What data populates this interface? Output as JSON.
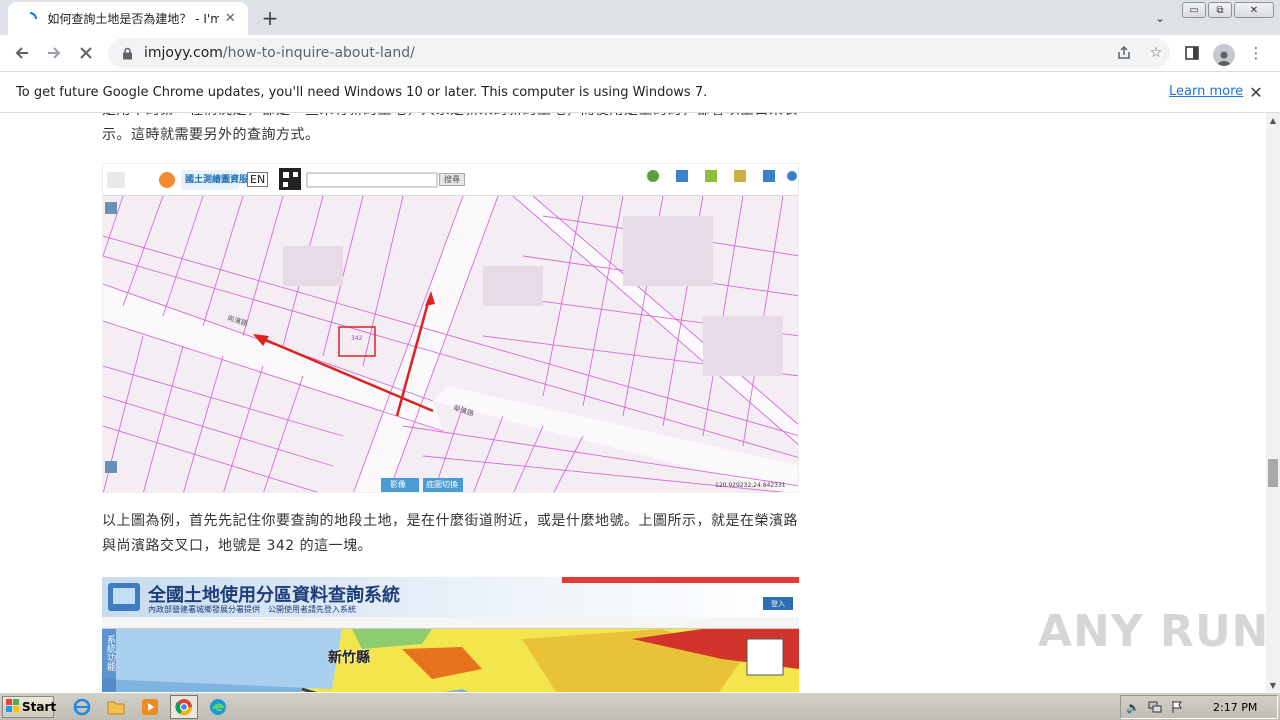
{
  "tab": {
    "title": "如何查詢土地是否為建地？ - I'm Joyy"
  },
  "window": {
    "minimize": "▭",
    "restore": "⧉",
    "close": "✕"
  },
  "address": {
    "domain": "imjoyy.com",
    "path": "/how-to-inquire-about-land/"
  },
  "infobar": {
    "message": "To get future Google Chrome updates, you'll need Windows 10 or later. This computer is using Windows 7.",
    "link": "Learn more"
  },
  "article": {
    "para_top": "是用中的第一種情況是，都是一些未有新的土地，大家是新來的新的土地，而使用是空的的，都會以空白來表示。這時就需要另外的查詢方式。",
    "para_mid": "以上圖為例，首先先記住你要查詢的地段土地，是在什麼街道附近，或是什麼地號。上圖所示，就是在榮濱路與尚濱路交叉口，地號是 342 的這一塊。",
    "fig1": {
      "brand": "國土測繪圖資服務雲",
      "lang": "EN",
      "search_btn": "搜尋",
      "map_btn_1": "影像",
      "map_btn_2": "底圖切換",
      "coords": "120.929232,24.842331",
      "parcel": "342",
      "street_1": "尚濱路",
      "street_2": "榮濱路"
    },
    "fig2": {
      "title": "全國土地使用分區資料查詢系統",
      "subtitle": "內政部營建署城鄉發展分署提供　公開使用者請先登入系統",
      "login": "登入",
      "county": "新竹縣",
      "side_label": "系統功能"
    }
  },
  "watermark": "ANY RUN",
  "taskbar": {
    "start": "Start",
    "time": "2:17 PM"
  }
}
